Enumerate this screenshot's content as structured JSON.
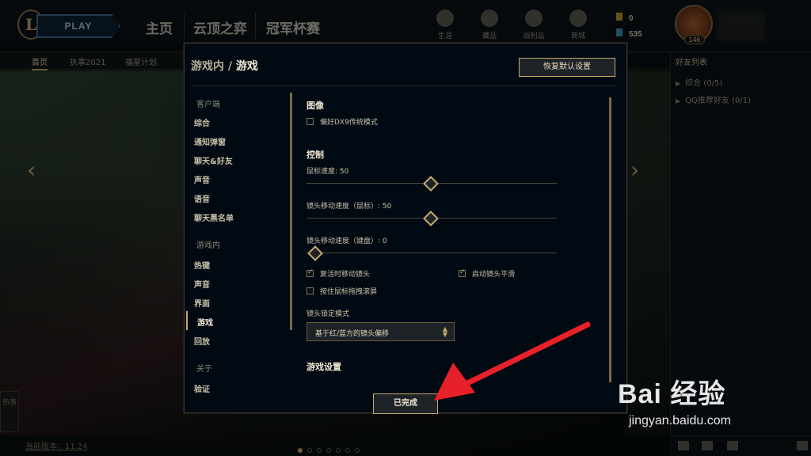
{
  "topbar": {
    "logo_letter": "L",
    "play": "PLAY",
    "nav": [
      "主页",
      "云顶之弈",
      "冠军杯赛"
    ],
    "icons": [
      {
        "icon": "profile-icon",
        "label": "生涯"
      },
      {
        "icon": "collection-icon",
        "label": "藏品"
      },
      {
        "icon": "loot-icon",
        "label": "战利品"
      },
      {
        "icon": "store-icon",
        "label": "商城"
      }
    ],
    "currency_be": "0",
    "currency_rp": "535",
    "level": "146"
  },
  "subnav": [
    "首页",
    "执事2021",
    "福星计划"
  ],
  "friends": {
    "header": "好友列表",
    "groups": [
      "综合 (0/5)",
      "QQ推荐好友 (0/1)"
    ]
  },
  "hot_tag": "热事",
  "version": "当前版本：11.24",
  "modal": {
    "breadcrumb_parent": "游戏内",
    "breadcrumb_sep": "/",
    "breadcrumb_current": "游戏",
    "reset_button": "恢复默认设置",
    "done_button": "已完成",
    "nav": {
      "client_category": "客户端",
      "client_items": [
        "综合",
        "通知弹窗",
        "聊天&好友",
        "声音",
        "语音",
        "聊天黑名单"
      ],
      "ingame_category": "游戏内",
      "ingame_items": [
        "热键",
        "声音",
        "界面",
        "游戏",
        "回放"
      ],
      "about_category": "关于",
      "about_items": [
        "验证"
      ]
    },
    "content": {
      "image_title": "图像",
      "image_dx9": {
        "label": "偏好DX9传统模式",
        "checked": false
      },
      "control_title": "控制",
      "mouse_speed": {
        "label": "鼠标速度: 50",
        "value": 50,
        "max": 100
      },
      "camera_mouse": {
        "label": "镜头移动速度（鼠标）: 50",
        "value": 50,
        "max": 100
      },
      "camera_keyboard": {
        "label": "镜头移动速度（键盘）: 0",
        "value": 0,
        "max": 100
      },
      "move_camera_on_respawn": {
        "label": "复活时移动镜头",
        "checked": true
      },
      "camera_smoothing": {
        "label": "启动镜头平滑",
        "checked": true
      },
      "drag_scroll": {
        "label": "按住鼠标拖拽滚屏",
        "checked": false
      },
      "camera_lock_label": "镜头锁定模式",
      "camera_lock_value": "基于红/蓝方的镜头偏移",
      "game_settings_title": "游戏设置"
    }
  },
  "watermark": {
    "main": "Bai 经验",
    "sub": "jingyan.baidu.com"
  },
  "colors": {
    "gold": "#c8aa6e",
    "arrow": "#e8202a",
    "panel": "#010a13"
  }
}
